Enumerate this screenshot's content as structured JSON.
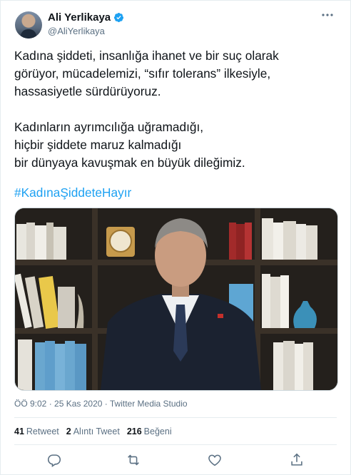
{
  "author": {
    "display_name": "Ali Yerlikaya",
    "handle": "@AliYerlikaya",
    "verified": true
  },
  "tweet": {
    "paragraph1": [
      "Kadına şiddeti, insanlığa ihanet ve bir suç olarak",
      "görüyor, mücadelemizi, “sıfır tolerans” ilkesiyle,",
      "hassasiyetle sürdürüyoruz."
    ],
    "paragraph2": [
      "Kadınların ayrımcılığa uğramadığı,",
      "hiçbir şiddete maruz kalmadığı",
      "bir dünyaya kavuşmak en büyük dileğimiz."
    ],
    "hashtag": "#KadınaŞiddeteHayır"
  },
  "meta": {
    "text": "ÖÖ 9:02 · 25 Kas 2020 · Twitter Media Studio"
  },
  "stats": {
    "retweets_count": "41",
    "retweets_label": "Retweet",
    "quotes_count": "2",
    "quotes_label": "Alıntı Tweet",
    "likes_count": "216",
    "likes_label": "Beğeni"
  },
  "icons": {
    "verified": "verified-badge-icon",
    "more": "more-options-icon",
    "reply": "reply-icon",
    "retweet": "retweet-icon",
    "like": "heart-icon",
    "share": "share-icon"
  },
  "colors": {
    "accent": "#1da1f2",
    "text": "#0f1419",
    "secondary": "#5b7083",
    "border": "#e6ecf0"
  }
}
